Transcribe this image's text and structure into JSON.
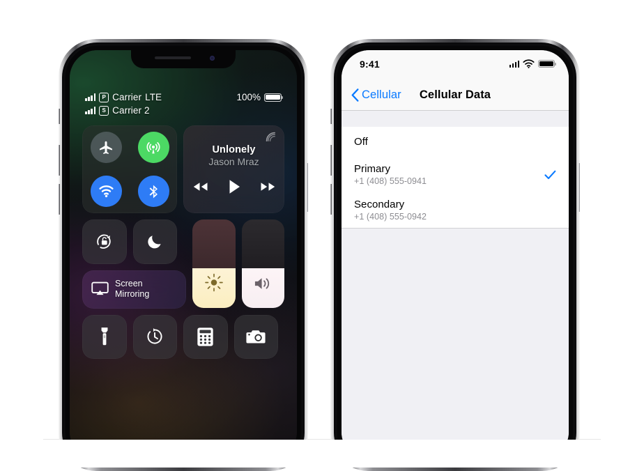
{
  "page": {
    "background_color": "#ffffff",
    "description": "Two iPhone X screenshots side by side: Control Center with dual-SIM status bar, and Settings > Cellular Data selection list"
  },
  "left_phone": {
    "device_name": "iPhone X",
    "frame_color": "#3a3a3e",
    "status_bar": {
      "carriers": [
        {
          "sim_badge": "P",
          "name": "Carrier",
          "network": "LTE",
          "signal_bars": 4
        },
        {
          "sim_badge": "S",
          "name": "Carrier 2",
          "network": "",
          "signal_bars": 4
        }
      ],
      "battery_percent": "100%",
      "battery_level": 100
    },
    "control_center": {
      "connectivity": {
        "tile_name": "connectivity-tile",
        "toggles": [
          {
            "name": "airplane-mode",
            "icon": "airplane-icon",
            "state": "off",
            "color": "#667076"
          },
          {
            "name": "cellular-data",
            "icon": "cellular-antenna-icon",
            "state": "on",
            "color": "#4cd964"
          },
          {
            "name": "wifi",
            "icon": "wifi-icon",
            "state": "on",
            "color": "#2e7cf6"
          },
          {
            "name": "bluetooth",
            "icon": "bluetooth-icon",
            "state": "on",
            "color": "#2e7cf6"
          }
        ]
      },
      "now_playing": {
        "title": "Unlonely",
        "artist": "Jason Mraz",
        "airplay_icon": "airplay-audio-icon",
        "controls": [
          {
            "name": "rewind-button",
            "icon": "rewind-icon"
          },
          {
            "name": "play-button",
            "icon": "play-icon"
          },
          {
            "name": "fast-forward-button",
            "icon": "fast-forward-icon"
          }
        ]
      },
      "rotation_lock": {
        "label": "Rotation Lock",
        "icon": "rotation-lock-icon",
        "state": "off"
      },
      "do_not_disturb": {
        "label": "Do Not Disturb",
        "icon": "moon-icon",
        "state": "off"
      },
      "screen_mirroring": {
        "label_line1": "Screen",
        "label_line2": "Mirroring",
        "icon": "airplay-video-icon"
      },
      "brightness_slider": {
        "name": "brightness",
        "icon": "brightness-sun-icon",
        "value_percent": 45
      },
      "volume_slider": {
        "name": "volume",
        "icon": "speaker-wave-icon",
        "value_percent": 45
      },
      "shortcuts": [
        {
          "name": "flashlight",
          "icon": "flashlight-icon"
        },
        {
          "name": "timer",
          "icon": "timer-icon"
        },
        {
          "name": "calculator",
          "icon": "calculator-icon"
        },
        {
          "name": "camera",
          "icon": "camera-icon"
        }
      ]
    }
  },
  "right_phone": {
    "device_name": "iPhone X",
    "frame_color": "#3a3a3e",
    "status_bar": {
      "time": "9:41",
      "signal_icon": "cellular-bars-icon",
      "wifi_icon": "wifi-icon",
      "battery_icon": "battery-full-icon",
      "battery_level": 100
    },
    "nav_bar": {
      "back_label": "Cellular",
      "back_icon": "chevron-left-icon",
      "title": "Cellular Data"
    },
    "list": {
      "rows": [
        {
          "title": "Off",
          "subtitle": "",
          "selected": false
        },
        {
          "title": "Primary",
          "subtitle": "+1 (408) 555-0941",
          "selected": true
        },
        {
          "title": "Secondary",
          "subtitle": "+1 (408) 555-0942",
          "selected": false
        }
      ],
      "checkmark_icon": "checkmark-icon",
      "accent_color": "#0a7aff"
    }
  }
}
